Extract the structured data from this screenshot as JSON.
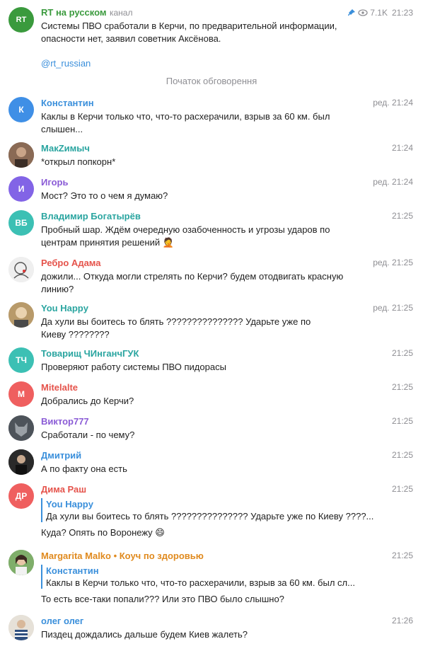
{
  "channel": {
    "name": "RT на русском",
    "tag": "канал",
    "views": "7.1K",
    "time": "21:23",
    "text_line1": "Системы ПВО сработали в Керчи, по предварительной информации,",
    "text_line2": "опасности нет, заявил советник Аксёнова.",
    "link": "@rt_russian",
    "avatar_text": "RT"
  },
  "divider": "Початок обговорення",
  "messages": [
    {
      "name": "Константин",
      "time": "ред. 21:24",
      "text1": "Каклы в Керчи только что, что-то расхерачили, взрыв за 60 км. был",
      "text2": "слышен...",
      "avatar": "К"
    },
    {
      "name": "МакZимыч",
      "time": "21:24",
      "text1": "*открыл попкорн*"
    },
    {
      "name": "Игорь",
      "time": "ред. 21:24",
      "text1": "Мост? Это то о чем я думаю?",
      "avatar": "И"
    },
    {
      "name": "Владимир Богатырёв",
      "time": "21:25",
      "text1": "Пробный шар. Ждём очередную озабоченность и угрозы ударов по",
      "text2": "центрам принятия решений 🤦",
      "avatar": "ВБ"
    },
    {
      "name": "Ребро Адама",
      "time": "ред. 21:25",
      "text1": "дожили... Откуда могли стрелять по Керчи? будем отодвигать красную",
      "text2": "линию?"
    },
    {
      "name": "You Happy",
      "time": "ред. 21:25",
      "text1": "Да хули вы боитесь то блять ??????????????? Ударьте уже по",
      "text2": "Киеву ????????"
    },
    {
      "name": "Товарищ ЧИнганчГУК",
      "time": "21:25",
      "text1": "Проверяют работу системы ПВО пидорасы",
      "avatar": "ТЧ"
    },
    {
      "name": "Mitelalte",
      "time": "21:25",
      "text1": "Добрались до Керчи?",
      "avatar": "M"
    },
    {
      "name": "Виктор777",
      "time": "21:25",
      "text1": "Сработали - по чему?"
    },
    {
      "name": "Дмитрий",
      "time": "21:25",
      "text1": "А по факту она есть"
    },
    {
      "name": "Дима Раш",
      "time": "21:25",
      "reply_name": "You Happy",
      "reply_text": "Да хули вы боитесь то блять ??????????????? Ударьте уже по Киеву ????...",
      "text1": "Куда? Опять по Воронежу 😄",
      "avatar": "ДР"
    },
    {
      "name": "Margarita Malko • Коуч по здоровью",
      "time": "21:25",
      "reply_name": "Константин",
      "reply_text": "Каклы в Керчи только что, что-то расхерачили, взрыв за 60 км. был сл...",
      "text1": "То есть все-таки попали??? Или это ПВО было слышно?"
    },
    {
      "name": "олег олег",
      "time": "21:26",
      "text1": "Пиздец дождались дальше будем Киев жалеть?"
    }
  ],
  "colors": {
    "link": "#3a8fdb",
    "name_blue": "#3a8fdb",
    "name_teal": "#2aa5a0",
    "name_purple": "#8a5bd6",
    "name_red": "#e5534b",
    "name_orange": "#e08a1e",
    "channel_green": "#2e9e4a"
  }
}
